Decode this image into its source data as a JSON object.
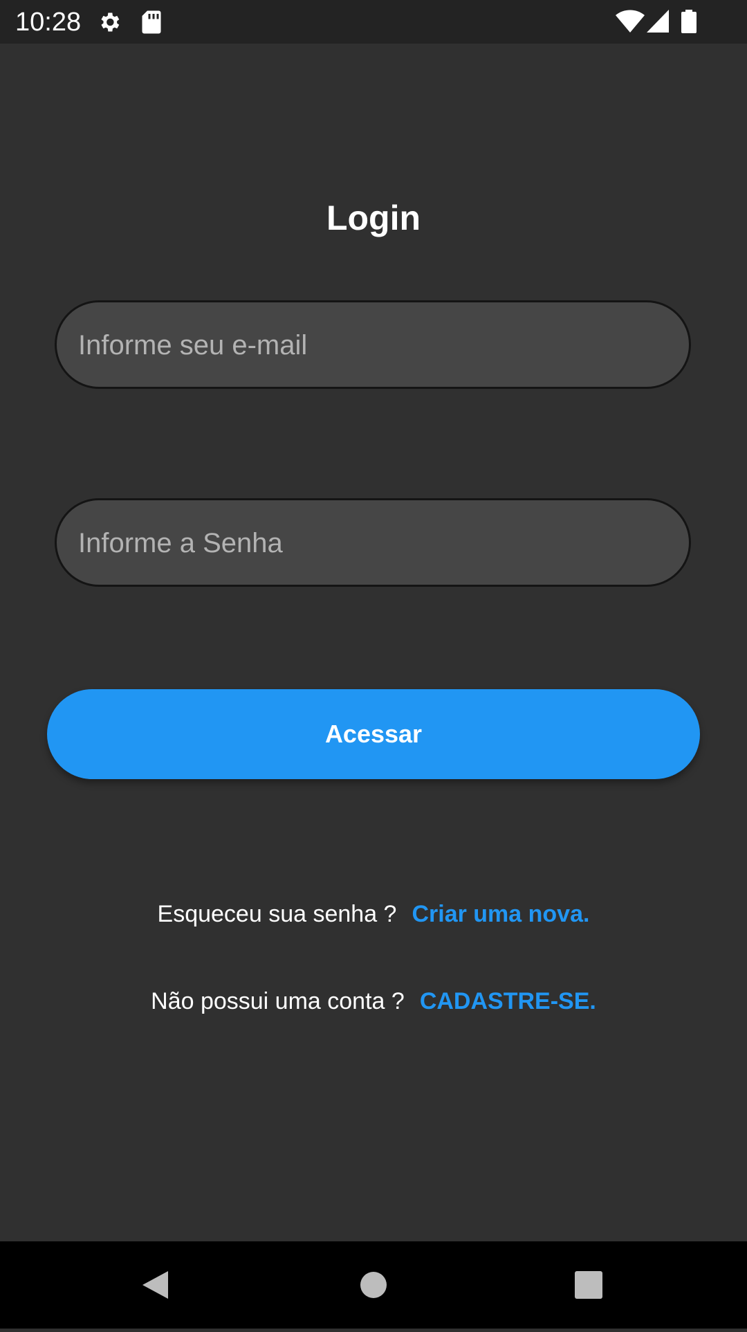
{
  "status_bar": {
    "time": "10:28",
    "icons": [
      "settings-icon",
      "sd-card-icon",
      "wifi-icon",
      "signal-icon",
      "battery-icon"
    ]
  },
  "login": {
    "title": "Login",
    "email_placeholder": "Informe seu e-mail",
    "email_value": "",
    "password_placeholder": "Informe a Senha",
    "password_value": "",
    "submit_label": "Acessar"
  },
  "forgot": {
    "prompt": "Esqueceu sua senha ?",
    "link": "Criar uma nova."
  },
  "signup": {
    "prompt": "Não possui uma conta ?",
    "link": "CADASTRE-SE."
  },
  "nav_bar": {
    "icons": [
      "back-icon",
      "home-icon",
      "recents-icon"
    ]
  },
  "colors": {
    "background": "#303030",
    "field_background": "#464646",
    "accent": "#2196f3",
    "status_bar": "#232323",
    "nav_bar": "#000000"
  }
}
